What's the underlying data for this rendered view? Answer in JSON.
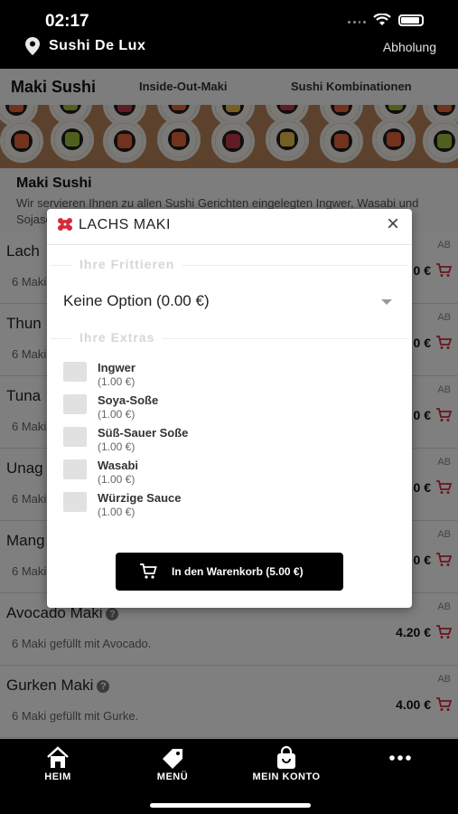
{
  "status_bar": {
    "time": "02:17"
  },
  "header": {
    "store_name": "Sushi De Lux",
    "pickup_label": "Abholung"
  },
  "tabs": [
    {
      "label": "Maki Sushi"
    },
    {
      "label": "Inside-Out-Maki"
    },
    {
      "label": "Sushi Kombinationen"
    }
  ],
  "section": {
    "title": "Maki Sushi",
    "description": "Wir servieren Ihnen zu allen Sushi Gerichten eingelegten Ingwer, Wasabi und Sojasoße."
  },
  "menu_items": [
    {
      "name": "Lach",
      "desc": "6 Maki",
      "ab": "AB",
      "price": "0 €"
    },
    {
      "name": "Thun",
      "desc": "6 Maki",
      "ab": "AB",
      "price": "0 €"
    },
    {
      "name": "Tuna",
      "desc": "6 Maki",
      "ab": "AB",
      "price": "0 €"
    },
    {
      "name": "Unag",
      "desc": "6 Maki",
      "ab": "AB",
      "price": "0 €"
    },
    {
      "name": "Mang",
      "desc": "6 Maki",
      "ab": "AB",
      "price": "0 €"
    },
    {
      "name": "Avocado Maki",
      "desc": "6 Maki gefüllt mit Avocado.",
      "ab": "AB",
      "price": "4.20 €"
    },
    {
      "name": "Gurken Maki",
      "desc": "6 Maki gefüllt mit Gurke.",
      "ab": "AB",
      "price": "4.00 €"
    }
  ],
  "info_glyph": "?",
  "modal": {
    "title": "LACHS MAKI",
    "close_glyph": "×",
    "fry_legend": "Ihre Frittieren",
    "fry_selected": "Keine Option (0.00 €)",
    "extras_legend": "Ihre Extras",
    "extras": [
      {
        "name": "Ingwer",
        "price": "(1.00 €)"
      },
      {
        "name": "Soya-Soße",
        "price": "(1.00 €)"
      },
      {
        "name": "Süß-Sauer Soße",
        "price": "(1.00 €)"
      },
      {
        "name": "Wasabi",
        "price": "(1.00 €)"
      },
      {
        "name": "Würzige Sauce",
        "price": "(1.00 €)"
      }
    ],
    "add_to_cart": "In den Warenkorb (5.00 €)"
  },
  "bottom_nav": [
    {
      "label": "HEIM",
      "icon": "home-icon"
    },
    {
      "label": "MENÜ",
      "icon": "tag-icon"
    },
    {
      "label": "MEIN KONTO",
      "icon": "bag-icon"
    },
    {
      "label": "",
      "icon": "more-icon"
    }
  ],
  "colors": {
    "accent": "#d8283c",
    "header": "#000000",
    "button": "#000000"
  }
}
